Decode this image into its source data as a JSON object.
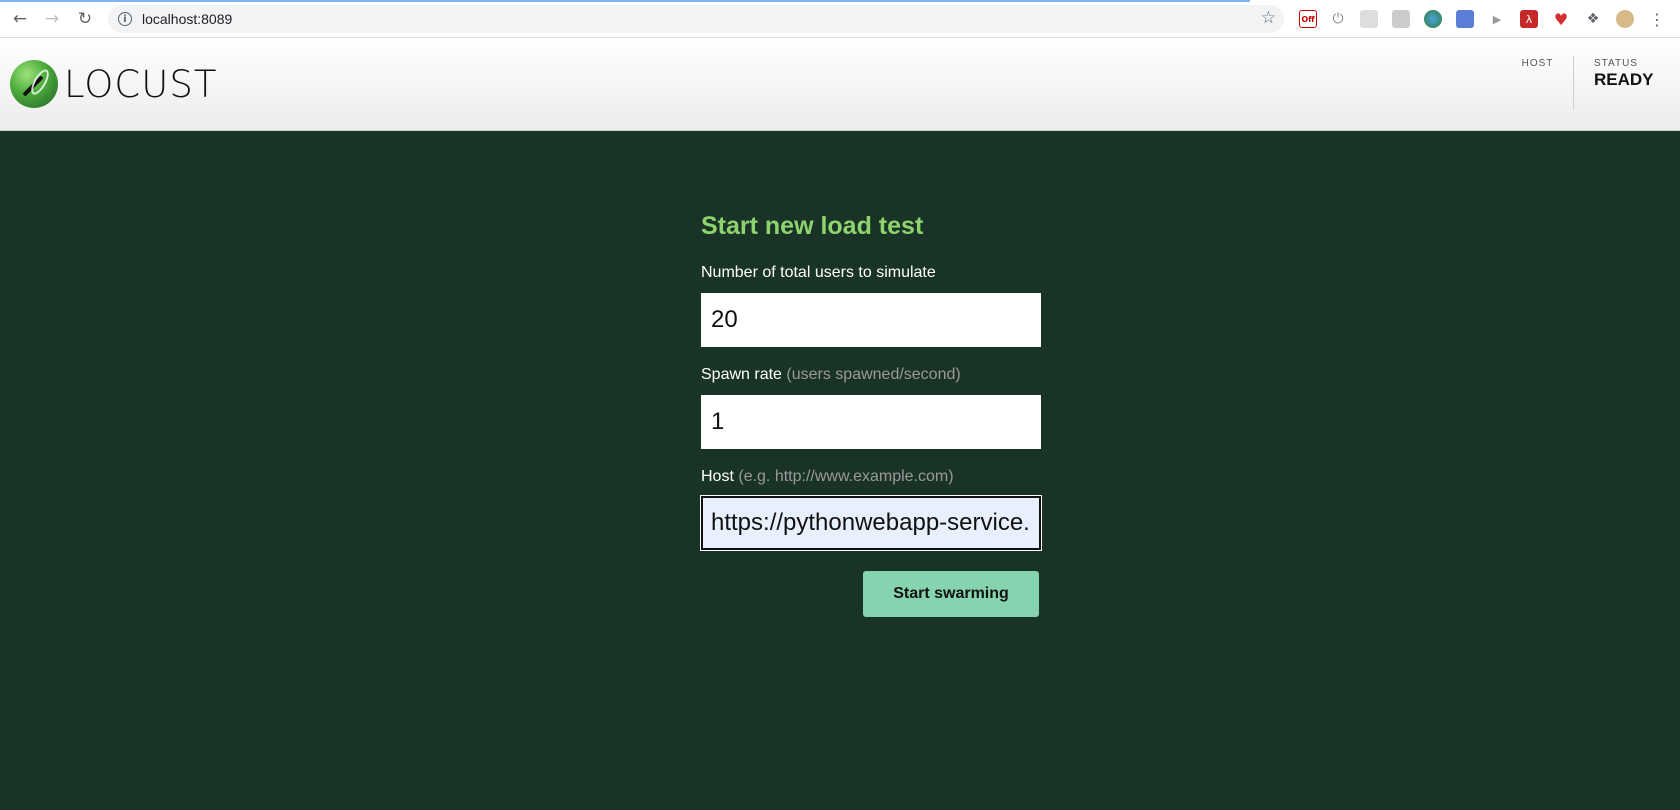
{
  "browser": {
    "url": "localhost:8089",
    "extensions": [
      "vimium-off-icon",
      "power-icon",
      "image-ext-icon",
      "window-ext-icon",
      "globe-icon",
      "camera-icon",
      "play-icon",
      "pdf-icon",
      "heart-icon",
      "puzzle-icon",
      "profile-avatar",
      "menu-dots-icon"
    ],
    "extension_badge": "Off"
  },
  "header": {
    "logo_text": "LOCUST",
    "host_label": "HOST",
    "status_label": "STATUS",
    "status_value": "READY"
  },
  "form": {
    "title": "Start new load test",
    "users_label": "Number of total users to simulate",
    "users_value": "20",
    "spawn_label": "Spawn rate",
    "spawn_hint": "(users spawned/second)",
    "spawn_value": "1",
    "host_label": "Host",
    "host_hint": "(e.g. http://www.example.com)",
    "host_value": "https://pythonwebapp-service.a",
    "submit_label": "Start swarming"
  },
  "colors": {
    "background": "#1a3327",
    "title": "#8fd36e",
    "button": "#86d4af"
  }
}
